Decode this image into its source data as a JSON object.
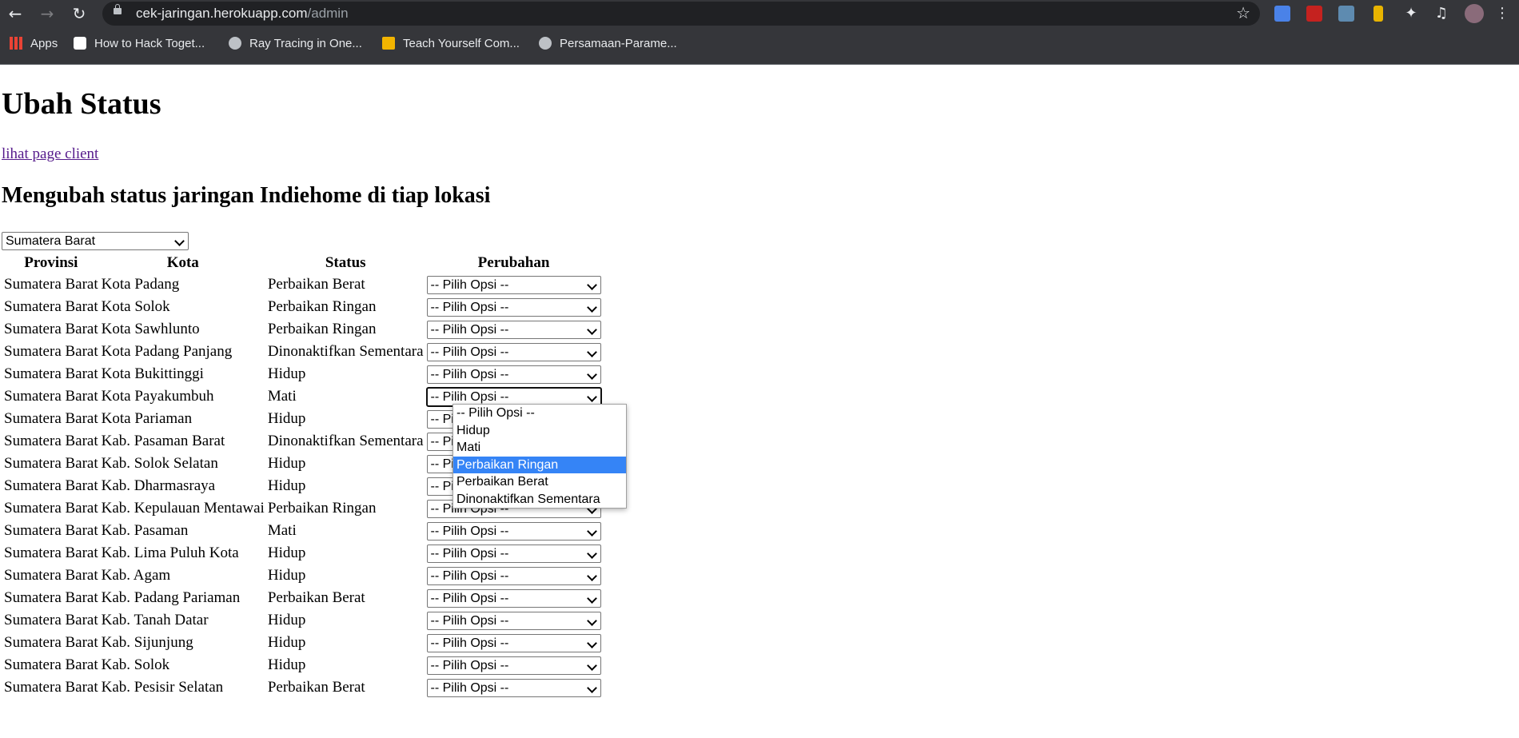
{
  "browser": {
    "url_host": "cek-jaringan.herokuapp.com",
    "url_path": "/admin",
    "bookmarks": [
      {
        "label": "Apps",
        "icon": "apps-grid-icon"
      },
      {
        "label": "How to Hack Toget...",
        "icon": "site-icon"
      },
      {
        "label": "Ray Tracing in One...",
        "icon": "globe-icon"
      },
      {
        "label": "Teach Yourself Com...",
        "icon": "key-icon"
      },
      {
        "label": "Persamaan-Parame...",
        "icon": "globe-icon"
      }
    ]
  },
  "page": {
    "title": "Ubah Status",
    "client_link": "lihat page client",
    "subtitle": "Mengubah status jaringan Indiehome di tiap lokasi",
    "province_selected": "Sumatera Barat"
  },
  "table": {
    "headers": [
      "Provinsi",
      "Kota",
      "Status",
      "Perubahan"
    ],
    "select_placeholder": "-- Pilih Opsi --",
    "rows": [
      {
        "provinsi": "Sumatera Barat",
        "kota": "Kota Padang",
        "status": "Perbaikan Berat"
      },
      {
        "provinsi": "Sumatera Barat",
        "kota": "Kota Solok",
        "status": "Perbaikan Ringan"
      },
      {
        "provinsi": "Sumatera Barat",
        "kota": "Kota Sawhlunto",
        "status": "Perbaikan Ringan"
      },
      {
        "provinsi": "Sumatera Barat",
        "kota": "Kota Padang Panjang",
        "status": "Dinonaktifkan Sementara"
      },
      {
        "provinsi": "Sumatera Barat",
        "kota": "Kota Bukittinggi",
        "status": "Hidup"
      },
      {
        "provinsi": "Sumatera Barat",
        "kota": "Kota Payakumbuh",
        "status": "Mati"
      },
      {
        "provinsi": "Sumatera Barat",
        "kota": "Kota Pariaman",
        "status": "Hidup"
      },
      {
        "provinsi": "Sumatera Barat",
        "kota": "Kab. Pasaman Barat",
        "status": "Dinonaktifkan Sementara"
      },
      {
        "provinsi": "Sumatera Barat",
        "kota": "Kab. Solok Selatan",
        "status": "Hidup"
      },
      {
        "provinsi": "Sumatera Barat",
        "kota": "Kab. Dharmasraya",
        "status": "Hidup"
      },
      {
        "provinsi": "Sumatera Barat",
        "kota": "Kab. Kepulauan Mentawai",
        "status": "Perbaikan Ringan"
      },
      {
        "provinsi": "Sumatera Barat",
        "kota": "Kab. Pasaman",
        "status": "Mati"
      },
      {
        "provinsi": "Sumatera Barat",
        "kota": "Kab. Lima Puluh Kota",
        "status": "Hidup"
      },
      {
        "provinsi": "Sumatera Barat",
        "kota": "Kab. Agam",
        "status": "Hidup"
      },
      {
        "provinsi": "Sumatera Barat",
        "kota": "Kab. Padang Pariaman",
        "status": "Perbaikan Berat"
      },
      {
        "provinsi": "Sumatera Barat",
        "kota": "Kab. Tanah Datar",
        "status": "Hidup"
      },
      {
        "provinsi": "Sumatera Barat",
        "kota": "Kab. Sijunjung",
        "status": "Hidup"
      },
      {
        "provinsi": "Sumatera Barat",
        "kota": "Kab. Solok",
        "status": "Hidup"
      },
      {
        "provinsi": "Sumatera Barat",
        "kota": "Kab. Pesisir Selatan",
        "status": "Perbaikan Berat"
      }
    ]
  },
  "dropdown": {
    "open_row": 5,
    "options": [
      "-- Pilih Opsi --",
      "Hidup",
      "Mati",
      "Perbaikan Ringan",
      "Perbaikan Berat",
      "Dinonaktifkan Sementara"
    ],
    "highlighted": "Perbaikan Ringan"
  }
}
